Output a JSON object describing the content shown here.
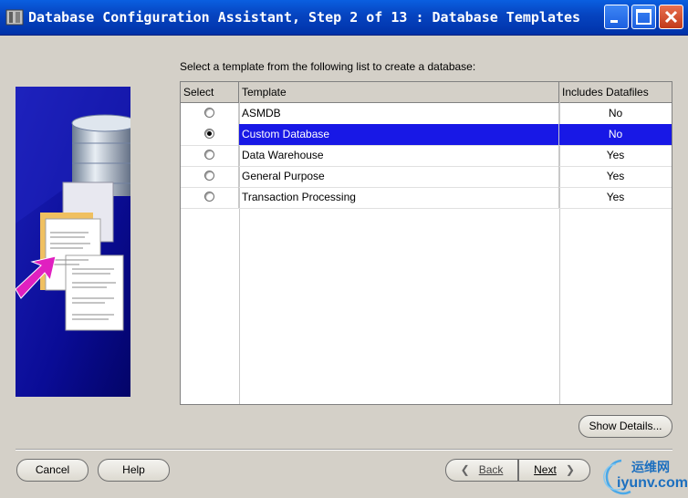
{
  "window": {
    "title": "Database Configuration Assistant, Step 2 of 13 : Database Templates"
  },
  "instruction": "Select a template from the following list to create a database:",
  "table": {
    "headers": [
      "Select",
      "Template",
      "Includes Datafiles"
    ],
    "rows": [
      {
        "template": "ASMDB",
        "datafiles": "No",
        "selected": false
      },
      {
        "template": "Custom Database",
        "datafiles": "No",
        "selected": true
      },
      {
        "template": "Data Warehouse",
        "datafiles": "Yes",
        "selected": false
      },
      {
        "template": "General Purpose",
        "datafiles": "Yes",
        "selected": false
      },
      {
        "template": "Transaction Processing",
        "datafiles": "Yes",
        "selected": false
      }
    ]
  },
  "buttons": {
    "show_details": "Show Details...",
    "cancel": "Cancel",
    "help": "Help",
    "back": "Back",
    "next": "Next"
  },
  "watermark": {
    "line1": "运维网",
    "line2": "iyunv.com"
  },
  "colors": {
    "titlebar": "#0645c2",
    "selection": "#1818e6",
    "graphic_bg": "#06088a"
  }
}
